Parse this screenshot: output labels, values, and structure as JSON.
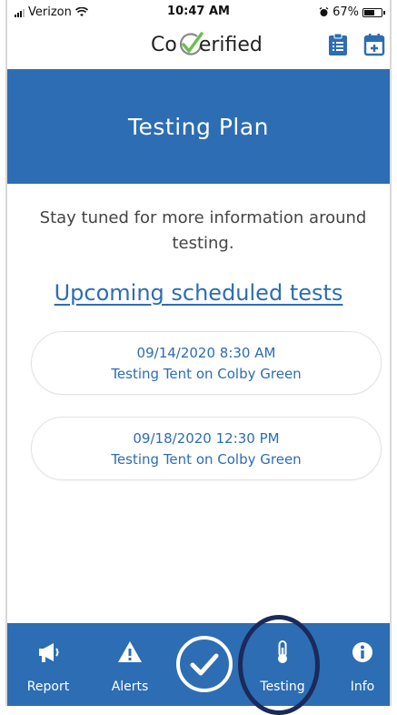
{
  "status_bar": {
    "carrier": "Verizon",
    "time": "10:47 AM",
    "battery": "67%",
    "battery_level": 0.67
  },
  "header": {
    "logo_prefix": "Co",
    "logo_suffix": "erified",
    "icons": [
      "clipboard-list-icon",
      "calendar-plus-icon"
    ]
  },
  "banner": {
    "title": "Testing Plan"
  },
  "main": {
    "intro": "Stay tuned for more information around testing.",
    "section_link": "Upcoming scheduled tests",
    "tests": [
      {
        "datetime": "09/14/2020 8:30 AM",
        "location": "Testing Tent on Colby Green"
      },
      {
        "datetime": "09/18/2020 12:30  PM",
        "location": "Testing Tent on Colby Green"
      }
    ]
  },
  "tabbar": {
    "tabs": [
      {
        "label": "Report",
        "icon": "megaphone-icon"
      },
      {
        "label": "Alerts",
        "icon": "warning-icon"
      },
      {
        "label": "",
        "icon": "check-circle-icon"
      },
      {
        "label": "Testing",
        "icon": "thermometer-icon"
      },
      {
        "label": "Info",
        "icon": "info-icon"
      }
    ]
  },
  "colors": {
    "primary": "#2d6db3",
    "logo_check": "#6bbf4e",
    "highlight_ring": "#1b2a5a"
  }
}
